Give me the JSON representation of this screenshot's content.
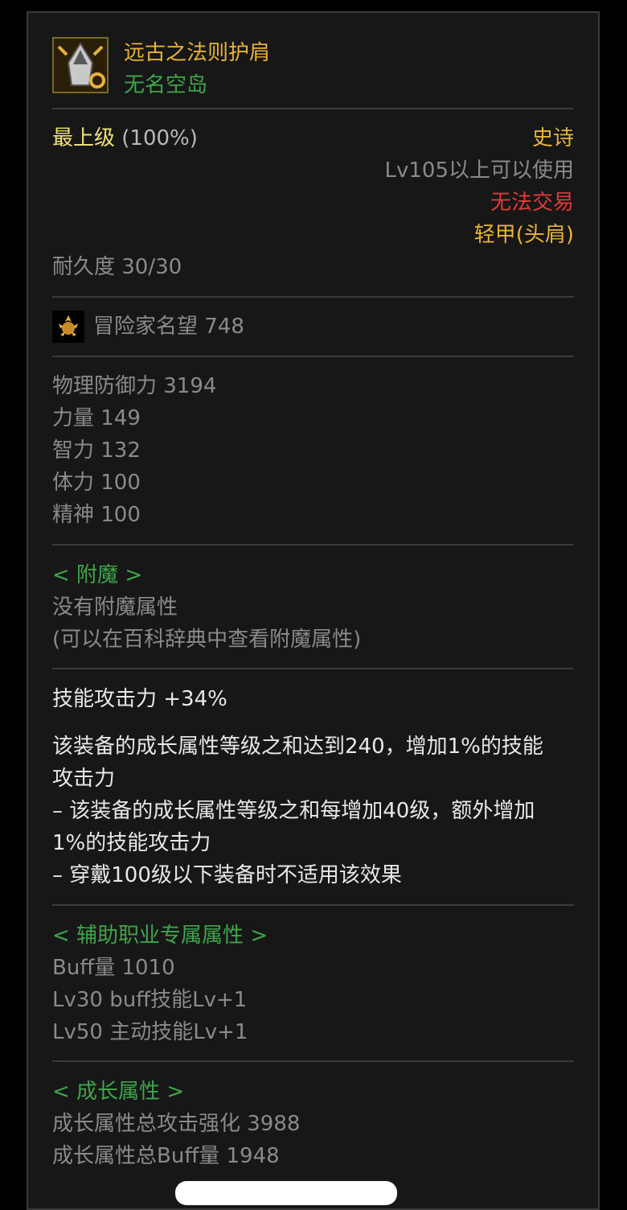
{
  "item": {
    "name": "远古之法则护肩",
    "set_name": "无名空岛",
    "grade": "最上级",
    "grade_pct": "(100%)",
    "rarity": "史诗",
    "level_req": "Lv105以上可以使用",
    "trade": "无法交易",
    "type": "轻甲(头肩)",
    "durability": "耐久度 30/30"
  },
  "fame": {
    "label": "冒险家名望 748"
  },
  "stats": [
    "物理防御力   3194",
    "力量   149",
    "智力   132",
    "体力   100",
    "精神   100"
  ],
  "enchant": {
    "header": "< 附魔 >",
    "line1": "没有附魔属性",
    "line2": "(可以在百科辞典中查看附魔属性)"
  },
  "skill": {
    "line": "技能攻击力   +34%",
    "desc": [
      "该装备的成长属性等级之和达到240，增加1%的技能",
      "攻击力",
      "– 该装备的成长属性等级之和每增加40级，额外增加",
      "1%的技能攻击力",
      "– 穿戴100级以下装备时不适用该效果"
    ]
  },
  "support": {
    "header": "< 辅助职业专属属性 >",
    "lines": [
      "Buff量   1010",
      "Lv30 buff技能Lv+1",
      "Lv50 主动技能Lv+1"
    ]
  },
  "growth": {
    "header": "< 成长属性 >",
    "lines": [
      "成长属性总攻击强化 3988",
      "成长属性总Buff量 1948"
    ]
  },
  "colors": {
    "gold": "#e6b23a",
    "green": "#3fa54a",
    "red": "#e03a3a",
    "gray": "#8a8a8a"
  }
}
